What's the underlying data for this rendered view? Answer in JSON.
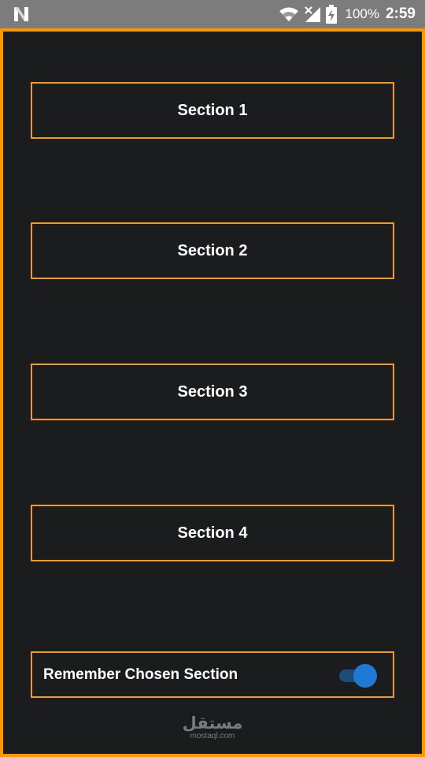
{
  "status_bar": {
    "left_icon": "n-notification-icon",
    "wifi_icon": "wifi-icon",
    "signal_icon": "no-signal-icon",
    "battery_icon": "battery-charging-icon",
    "battery_percent": "100%",
    "time": "2:59"
  },
  "sections": [
    {
      "label": "Section 1"
    },
    {
      "label": "Section 2"
    },
    {
      "label": "Section 3"
    },
    {
      "label": "Section 4"
    }
  ],
  "remember": {
    "label": "Remember Chosen Section",
    "enabled": true
  },
  "watermark": {
    "logo": "مستقل",
    "url": "mostaql.com"
  },
  "colors": {
    "background": "#1b1c1e",
    "accent_orange": "#ff9800",
    "toggle_on": "#1e7ad4",
    "status_bar": "#7c7c7c"
  }
}
